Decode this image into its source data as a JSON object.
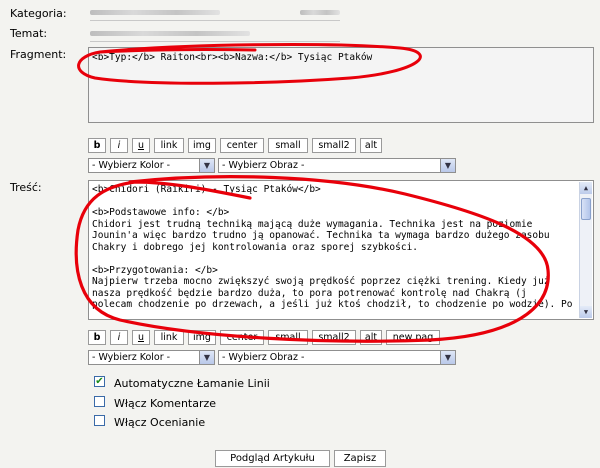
{
  "labels": {
    "category": "Kategoria:",
    "topic": "Temat:",
    "fragment": "Fragment:",
    "content": "Treść:"
  },
  "fragment": {
    "text": "<b>Typ:</b> Raiton<br><b>Nazwa:</b> Tysiąc Ptaków"
  },
  "content": {
    "lines": [
      "<b>Chidori (Raikiri) - Tysiąc Ptaków</b>",
      "",
      "<b>Podstawowe info: </b>",
      "Chidori jest trudną techniką mającą duże wymagania. Technika jest na poziomie",
      "Jounin'a więc bardzo trudno ją opanować. Technika ta wymaga bardzo dużego zasobu",
      "Chakry i dobrego jej kontrolowania oraz sporej szybkości.",
      "",
      "<b>Przygotowania: </b>",
      "Najpierw trzeba mocno zwiększyć swoją prędkość poprzez ciężki trening. Kiedy już",
      "nasza prędkość będzie bardzo duża, to pora potrenować kontrolę nad Chakrą (j",
      "polecam chodzenie po drzewach, a jeśli już ktoś chodził, to chodzenie po wodzie). Po"
    ]
  },
  "toolbar": {
    "buttons": [
      "b",
      "i",
      "u",
      "link",
      "img",
      "center",
      "small",
      "small2",
      "alt"
    ],
    "extra_button": "new pag"
  },
  "selects": {
    "color_1": "- Wybierz Kolor -",
    "image_1": "- Wybierz Obraz -",
    "color_2": "- Wybierz Kolor -",
    "image_2": "- Wybierz Obraz -"
  },
  "options": [
    {
      "label": "Automatyczne Łamanie Linii",
      "checked": true
    },
    {
      "label": "Włącz Komentarze",
      "checked": false
    },
    {
      "label": "Włącz Ocenianie",
      "checked": false
    }
  ],
  "actions": {
    "preview": "Podgląd Artykułu",
    "save": "Zapisz"
  },
  "annotation_color": "#e8000a"
}
